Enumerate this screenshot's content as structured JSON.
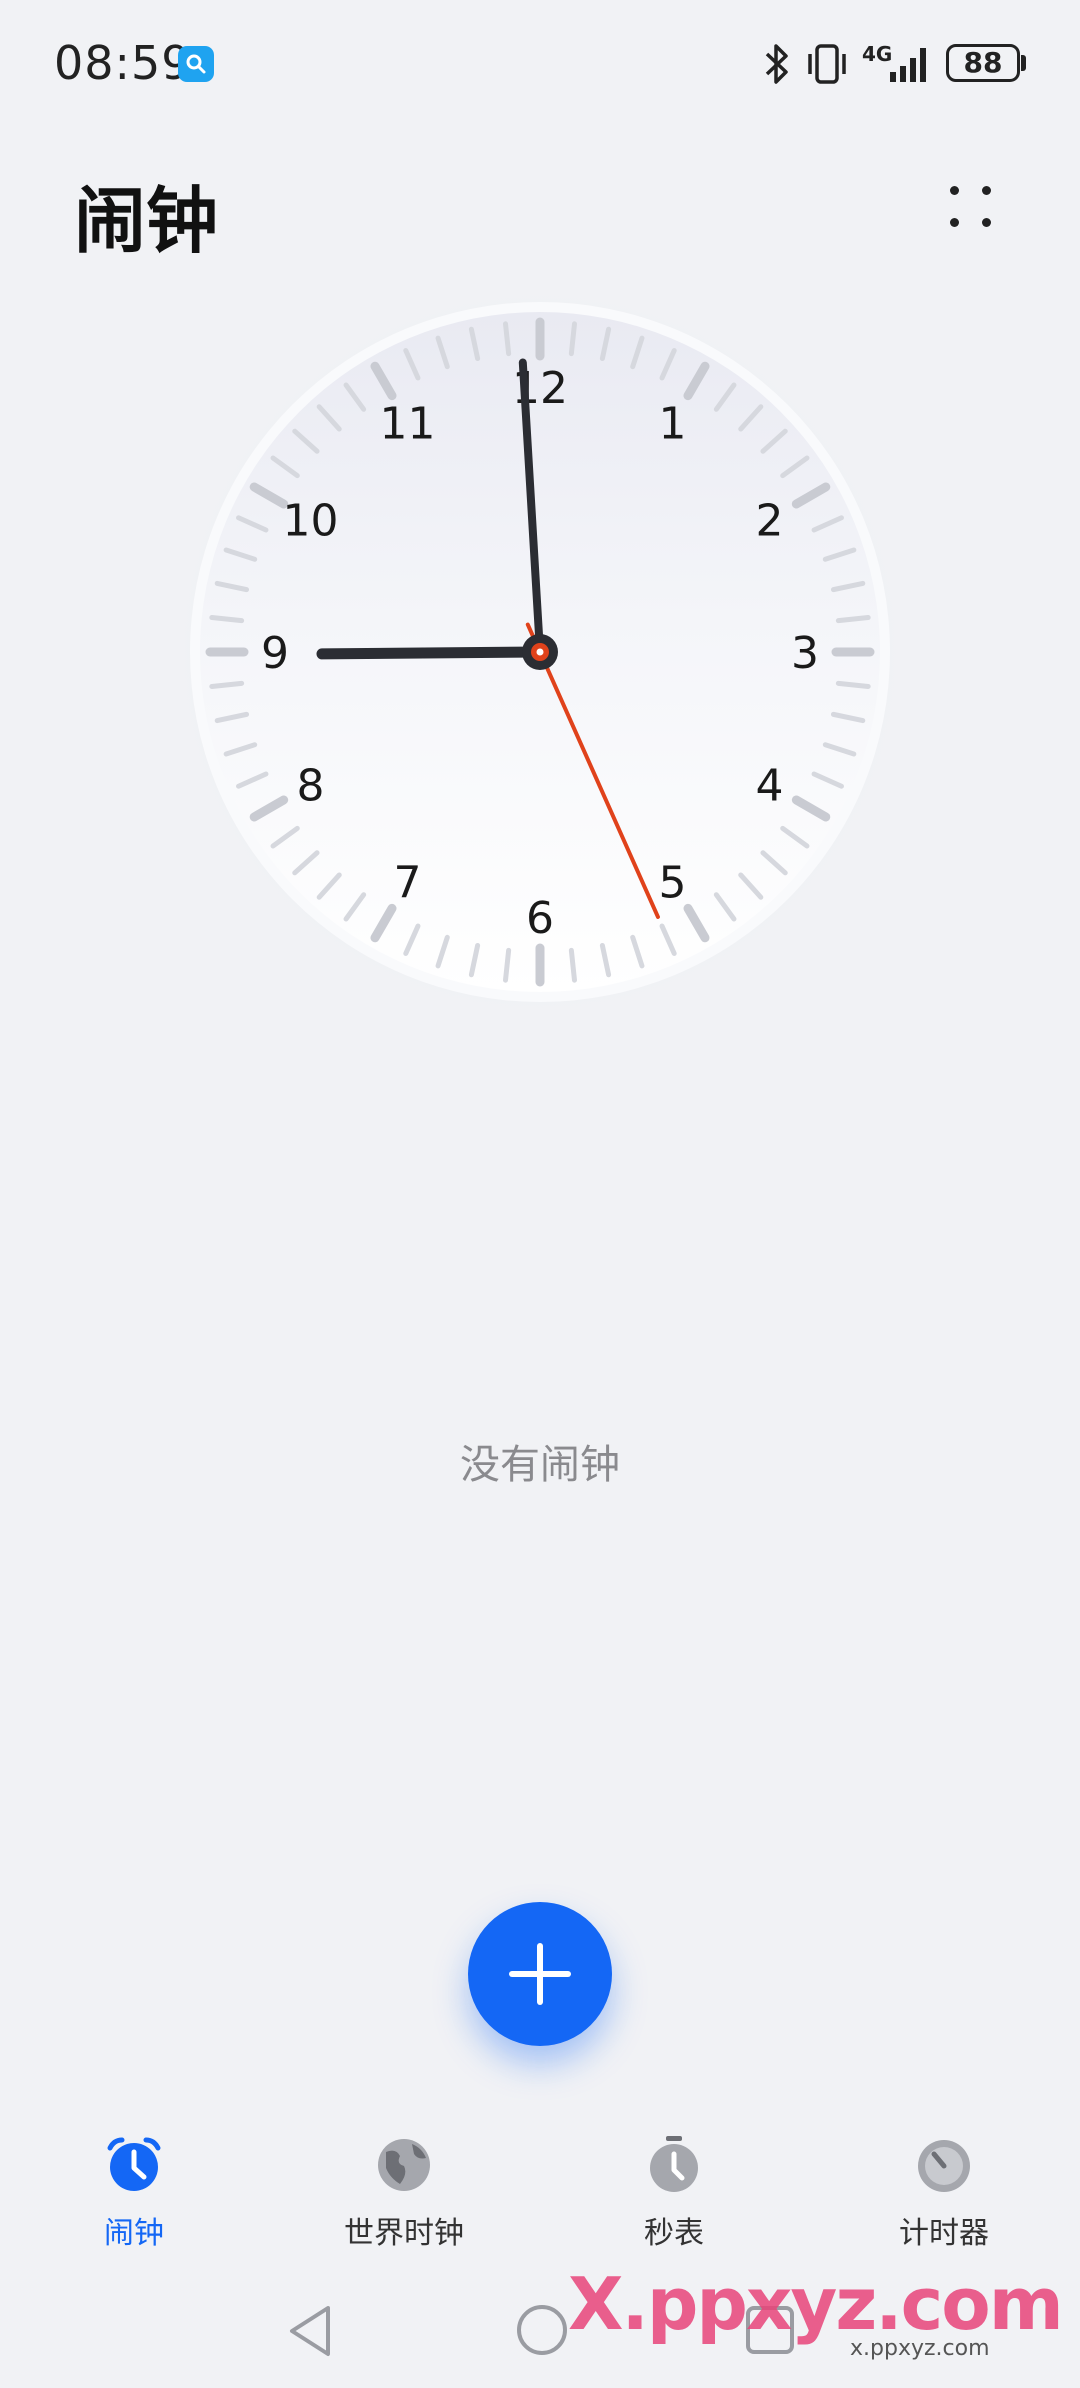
{
  "status_bar": {
    "time": "08:59",
    "network": "4G",
    "battery": "88",
    "icons": [
      "search-app-icon",
      "bluetooth-icon",
      "vibrate-icon",
      "signal-icon",
      "battery-icon"
    ]
  },
  "header": {
    "title": "闹钟",
    "more_icon": "more-dots-icon"
  },
  "clock": {
    "numerals": [
      "12",
      "1",
      "2",
      "3",
      "4",
      "5",
      "6",
      "7",
      "8",
      "9",
      "10",
      "11"
    ],
    "time_shown": "08:59:26",
    "colors": {
      "hands": "#2b2d33",
      "second_hand": "#e0421b",
      "face": "#f7f8fb"
    }
  },
  "main": {
    "empty_text": "没有闹钟"
  },
  "fab": {
    "icon": "plus-icon",
    "color": "#1467f5"
  },
  "bottom_nav": {
    "items": [
      {
        "label": "闹钟",
        "icon": "alarm-clock-icon",
        "active": true
      },
      {
        "label": "世界时钟",
        "icon": "globe-icon",
        "active": false
      },
      {
        "label": "秒表",
        "icon": "stopwatch-icon",
        "active": false
      },
      {
        "label": "计时器",
        "icon": "timer-icon",
        "active": false
      }
    ],
    "active_color": "#1467f5"
  },
  "system_nav": {
    "icons": [
      "back-icon",
      "home-icon",
      "recents-icon"
    ]
  },
  "watermark": {
    "text": "X.ppxyz.com",
    "sub": "x.ppxyz.com"
  }
}
